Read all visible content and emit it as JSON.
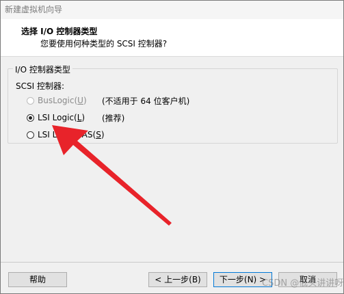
{
  "window": {
    "title": "新建虚拟机向导"
  },
  "header": {
    "title": "选择 I/O 控制器类型",
    "subtitle": "您要使用何种类型的 SCSI 控制器?"
  },
  "group": {
    "legend": "I/O 控制器类型",
    "scsi_label": "SCSI 控制器:"
  },
  "options": [
    {
      "label": "BusLogic(",
      "key": "U",
      "close": ")",
      "note": "(不适用于 64 位客户机)",
      "state": "disabled"
    },
    {
      "label": "LSI Logic(",
      "key": "L",
      "close": ")",
      "note": "(推荐)",
      "state": "checked"
    },
    {
      "label": "LSI Logic SAS(",
      "key": "S",
      "close": ")",
      "note": "",
      "state": "unchecked"
    }
  ],
  "buttons": {
    "help": "帮助",
    "back": "< 上一步(B)",
    "next": "下一步(N) >",
    "cancel": "取消"
  },
  "watermark": "CSDN @低头讲讲呀",
  "colors": {
    "arrow": "#e8232a",
    "focus_border": "#0078d7"
  }
}
